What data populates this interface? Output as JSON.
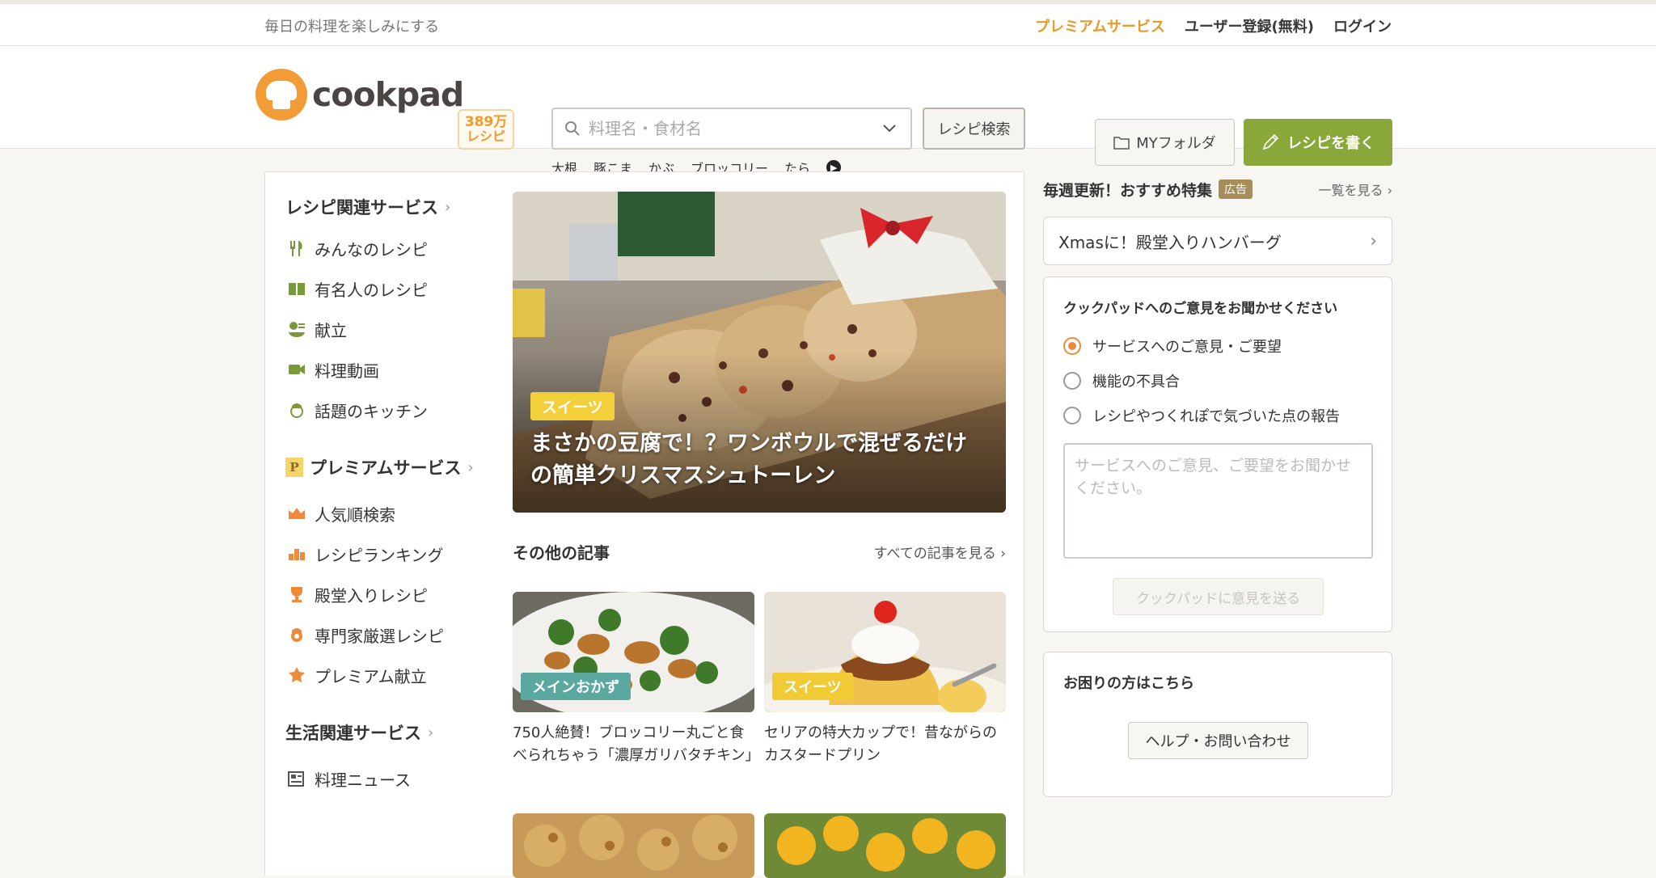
{
  "topbar": {
    "tagline": "毎日の料理を楽しみにする",
    "premium": "プレミアムサービス",
    "register": "ユーザー登録(無料)",
    "login": "ログイン"
  },
  "header": {
    "logo_text": "cookpad",
    "recipe_count_num": "389万",
    "recipe_count_unit": "レシピ",
    "search_placeholder": "料理名・食材名",
    "search_button": "レシピ検索",
    "keywords": [
      "大根",
      "豚こま",
      "かぶ",
      "ブロッコリー",
      "たら"
    ],
    "folder_button": "MYフォルダ",
    "write_button": "レシピを書く"
  },
  "sidebar": {
    "sections": [
      {
        "title": "レシピ関連サービス",
        "items": [
          {
            "label": "みんなのレシピ",
            "icon": "fork-knife-icon"
          },
          {
            "label": "有名人のレシピ",
            "icon": "book-icon"
          },
          {
            "label": "献立",
            "icon": "menu-plan-icon"
          },
          {
            "label": "料理動画",
            "icon": "video-camera-icon"
          },
          {
            "label": "話題のキッチン",
            "icon": "chef-icon"
          }
        ]
      },
      {
        "title": "プレミアムサービス",
        "badge": "P",
        "items": [
          {
            "label": "人気順検索",
            "icon": "crown-icon"
          },
          {
            "label": "レシピランキング",
            "icon": "podium-icon"
          },
          {
            "label": "殿堂入りレシピ",
            "icon": "trophy-icon"
          },
          {
            "label": "専門家厳選レシピ",
            "icon": "expert-icon"
          },
          {
            "label": "プレミアム献立",
            "icon": "star-menu-icon"
          }
        ]
      },
      {
        "title": "生活関連サービス",
        "items": [
          {
            "label": "料理ニュース",
            "icon": "newspaper-icon"
          }
        ]
      }
    ]
  },
  "feature": {
    "tag": "スイーツ",
    "title": "まさかの豆腐で！？ワンボウルで混ぜるだけの簡単クリスマスシュトーレン"
  },
  "others": {
    "title": "その他の記事",
    "see_all": "すべての記事を見る",
    "cards": [
      {
        "tag": "メインおかず",
        "tag_color": "#5aa8a0",
        "caption": "750人絶賛！ブロッコリー丸ごと食べられちゃう「濃厚ガリバタチキン」"
      },
      {
        "tag": "スイーツ",
        "tag_color": "#f0cb35",
        "caption": "セリアの特大カップで！昔ながらのカスタードプリン"
      }
    ]
  },
  "right": {
    "ad_title": "毎週更新！おすすめ特集",
    "ad_badge": "広告",
    "ad_more": "一覧を見る",
    "ad_link": "Xmasに！殿堂入りハンバーグ",
    "feedback": {
      "title": "クックパッドへのご意見をお聞かせください",
      "options": [
        "サービスへのご意見・ご要望",
        "機能の不具合",
        "レシピやつくれぽで気づいた点の報告"
      ],
      "selected": 0,
      "placeholder": "サービスへのご意見、ご要望をお聞かせください。",
      "send": "クックパッドに意見を送る"
    },
    "help": {
      "title": "お困りの方はこちら",
      "button": "ヘルプ・お問い合わせ"
    }
  },
  "colors": {
    "brand_orange": "#f29c38",
    "write_green": "#8aa83a",
    "premium_text": "#e8992a"
  }
}
